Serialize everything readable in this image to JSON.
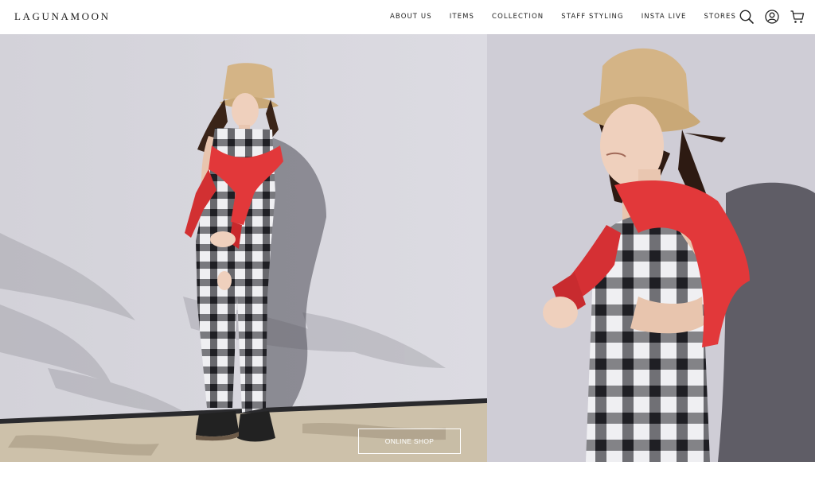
{
  "brand": {
    "logo_text": "LAGUNAMOON"
  },
  "nav": {
    "items": [
      {
        "label": "ABOUT US"
      },
      {
        "label": "ITEMS"
      },
      {
        "label": "COLLECTION"
      },
      {
        "label": "STAFF STYLING"
      },
      {
        "label": "INSTA LIVE"
      },
      {
        "label": "STORES"
      }
    ]
  },
  "header_icons": [
    "search-icon",
    "account-icon",
    "cart-icon"
  ],
  "hero": {
    "cta_label": "ONLINE SHOP",
    "colors": {
      "wall": "#d7d6dd",
      "floor": "#cfc3ad",
      "cardigan": "#e2383a",
      "hat": "#d4b486",
      "plaid_dark": "#2b2b30",
      "plaid_light": "#efeff2"
    }
  }
}
